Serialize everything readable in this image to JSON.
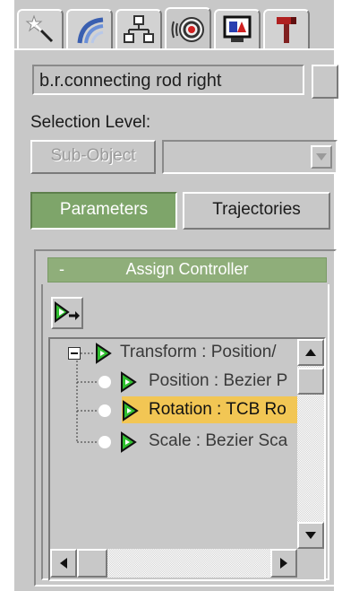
{
  "tabs": [
    {
      "name": "create-tab",
      "icon": "magic-wand-icon"
    },
    {
      "name": "modify-tab",
      "icon": "bend-arc-icon"
    },
    {
      "name": "hierarchy-tab",
      "icon": "hierarchy-icon"
    },
    {
      "name": "motion-tab",
      "icon": "motion-wheel-icon",
      "active": true
    },
    {
      "name": "display-tab",
      "icon": "display-monitor-icon"
    },
    {
      "name": "utilities-tab",
      "icon": "hammer-icon"
    }
  ],
  "object_name": "b.r.connecting rod right",
  "selection": {
    "label": "Selection Level:",
    "subobject_label": "Sub-Object",
    "dropdown_value": ""
  },
  "mode_buttons": {
    "parameters": "Parameters",
    "trajectories": "Trajectories"
  },
  "rollout": {
    "collapse_symbol": "-",
    "title": "Assign Controller"
  },
  "tree": {
    "items": [
      {
        "label": "Transform : Position/",
        "level": 0,
        "expander": "minus"
      },
      {
        "label": "Position : Bezier P",
        "level": 1
      },
      {
        "label": "Rotation : TCB Ro",
        "level": 1,
        "selected": true
      },
      {
        "label": "Scale : Bezier Sca",
        "level": 1
      }
    ]
  },
  "colors": {
    "panel": "#c8c8c8",
    "active_green": "#7ea56a",
    "rollout_green": "#8fae7a",
    "selection_yellow": "#f2c654",
    "controller_green": "#2fbf2f"
  }
}
